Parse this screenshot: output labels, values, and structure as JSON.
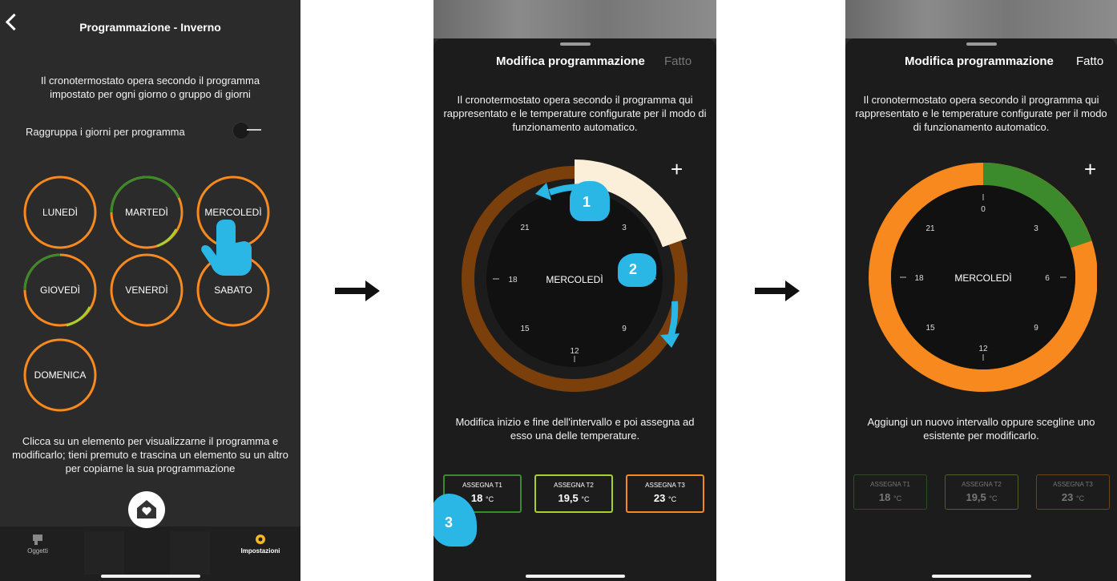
{
  "screen1": {
    "title": "Programmazione - Inverno",
    "intro": "Il cronotermostato opera secondo il programma impostato per ogni giorno o gruppo di giorni",
    "toggle_label": "Raggruppa i giorni per programma",
    "days": [
      "LUNEDÌ",
      "MARTEDÌ",
      "MERCOLEDÌ",
      "GIOVEDÌ",
      "VENERDÌ",
      "SABATO",
      "DOMENICA"
    ],
    "footer": "Clicca su un elemento per visualizzarne il programma e modificarlo; tieni premuto e trascina un elemento su un altro per copiarne la sua programmazione",
    "tabs": [
      "Oggetti",
      "Impostazioni"
    ]
  },
  "screen2": {
    "header": "Modifica programmazione",
    "done": "Fatto",
    "intro": "Il cronotermostato opera secondo il programma qui rappresentato e le temperature configurate per il modo di funzionamento automatico.",
    "day": "MERCOLEDÌ",
    "hours": [
      "21",
      "3",
      "18",
      "9",
      "15",
      "12"
    ],
    "plus": "+",
    "instructions": "Modifica inizio e fine dell'intervallo e poi assegna ad esso una delle temperature.",
    "buttons": [
      {
        "label": "ASSEGNA T1",
        "value": "18",
        "unit": "°C"
      },
      {
        "label": "ASSEGNA T2",
        "value": "19,5",
        "unit": "°C"
      },
      {
        "label": "ASSEGNA T3",
        "value": "23",
        "unit": "°C"
      }
    ],
    "callouts": [
      "1",
      "2",
      "3"
    ]
  },
  "screen3": {
    "header": "Modifica programmazione",
    "done": "Fatto",
    "intro": "Il cronotermostato opera secondo il programma qui rappresentato e le temperature configurate per il modo di funzionamento automatico.",
    "day": "MERCOLEDÌ",
    "hours": [
      "0",
      "21",
      "3",
      "18",
      "6",
      "15",
      "9",
      "12"
    ],
    "plus": "+",
    "instructions": "Aggiungi un nuovo intervallo oppure scegline uno esistente per modificarlo.",
    "buttons": [
      {
        "label": "ASSEGNA T1",
        "value": "18",
        "unit": "°C"
      },
      {
        "label": "ASSEGNA T2",
        "value": "19,5",
        "unit": "°C"
      },
      {
        "label": "ASSEGNA T3",
        "value": "23",
        "unit": "°C"
      }
    ]
  },
  "colors": {
    "orange": "#f7891e",
    "green": "#3b8a2b",
    "lime": "#a8d22b",
    "brown": "#7a3f0a",
    "cream": "#fbefd9",
    "hint_blue": "#2bb7e6"
  },
  "icons": [
    "back-chevron-icon",
    "home-heart-icon",
    "objects-icon",
    "settings-gear-icon",
    "hand-pointer-icon",
    "right-arrow-icon"
  ]
}
